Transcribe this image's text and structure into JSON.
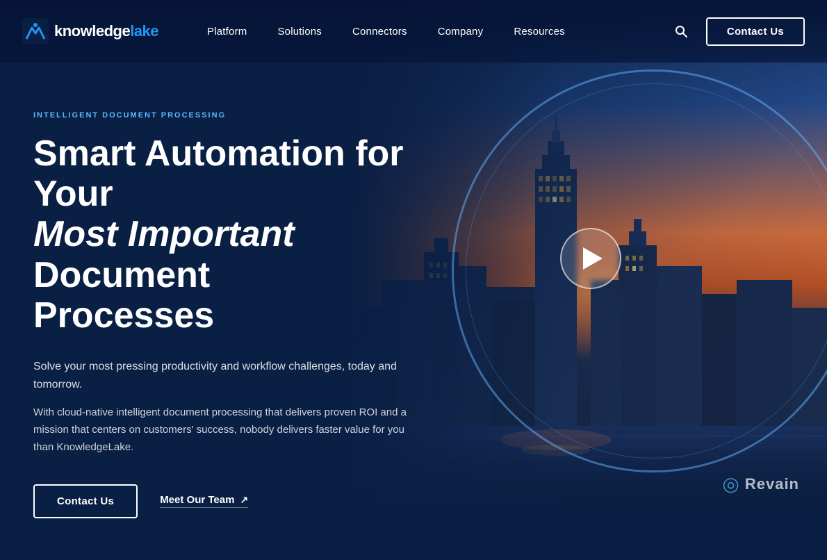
{
  "header": {
    "logo": {
      "knowledge": "knowledge",
      "lake": "lake",
      "aria": "KnowledgeLake logo"
    },
    "nav": {
      "items": [
        {
          "id": "platform",
          "label": "Platform"
        },
        {
          "id": "solutions",
          "label": "Solutions"
        },
        {
          "id": "connectors",
          "label": "Connectors"
        },
        {
          "id": "company",
          "label": "Company"
        },
        {
          "id": "resources",
          "label": "Resources"
        }
      ],
      "search_aria": "Search",
      "contact_label": "Contact Us"
    }
  },
  "hero": {
    "tag": "INTELLIGENT DOCUMENT PROCESSING",
    "title_line1": "Smart Automation for Your",
    "title_line2_italic": "Most Important",
    "title_line2_rest": " Document",
    "title_line3": "Processes",
    "subtitle": "Solve your most pressing productivity and workflow challenges, today and tomorrow.",
    "body": "With cloud-native intelligent document processing that delivers proven ROI and a mission that centers on customers' success, nobody delivers faster value for you than KnowledgeLake.",
    "cta_contact": "Contact Us",
    "cta_meet": "Meet Our Team",
    "play_aria": "Play video"
  },
  "footer_brand": {
    "icon": "◎",
    "text": "Revain"
  },
  "colors": {
    "accent": "#5bb8ff",
    "brand_dark": "#0a1f44",
    "tag_color": "#5bb8ff",
    "btn_border": "#ffffff"
  }
}
